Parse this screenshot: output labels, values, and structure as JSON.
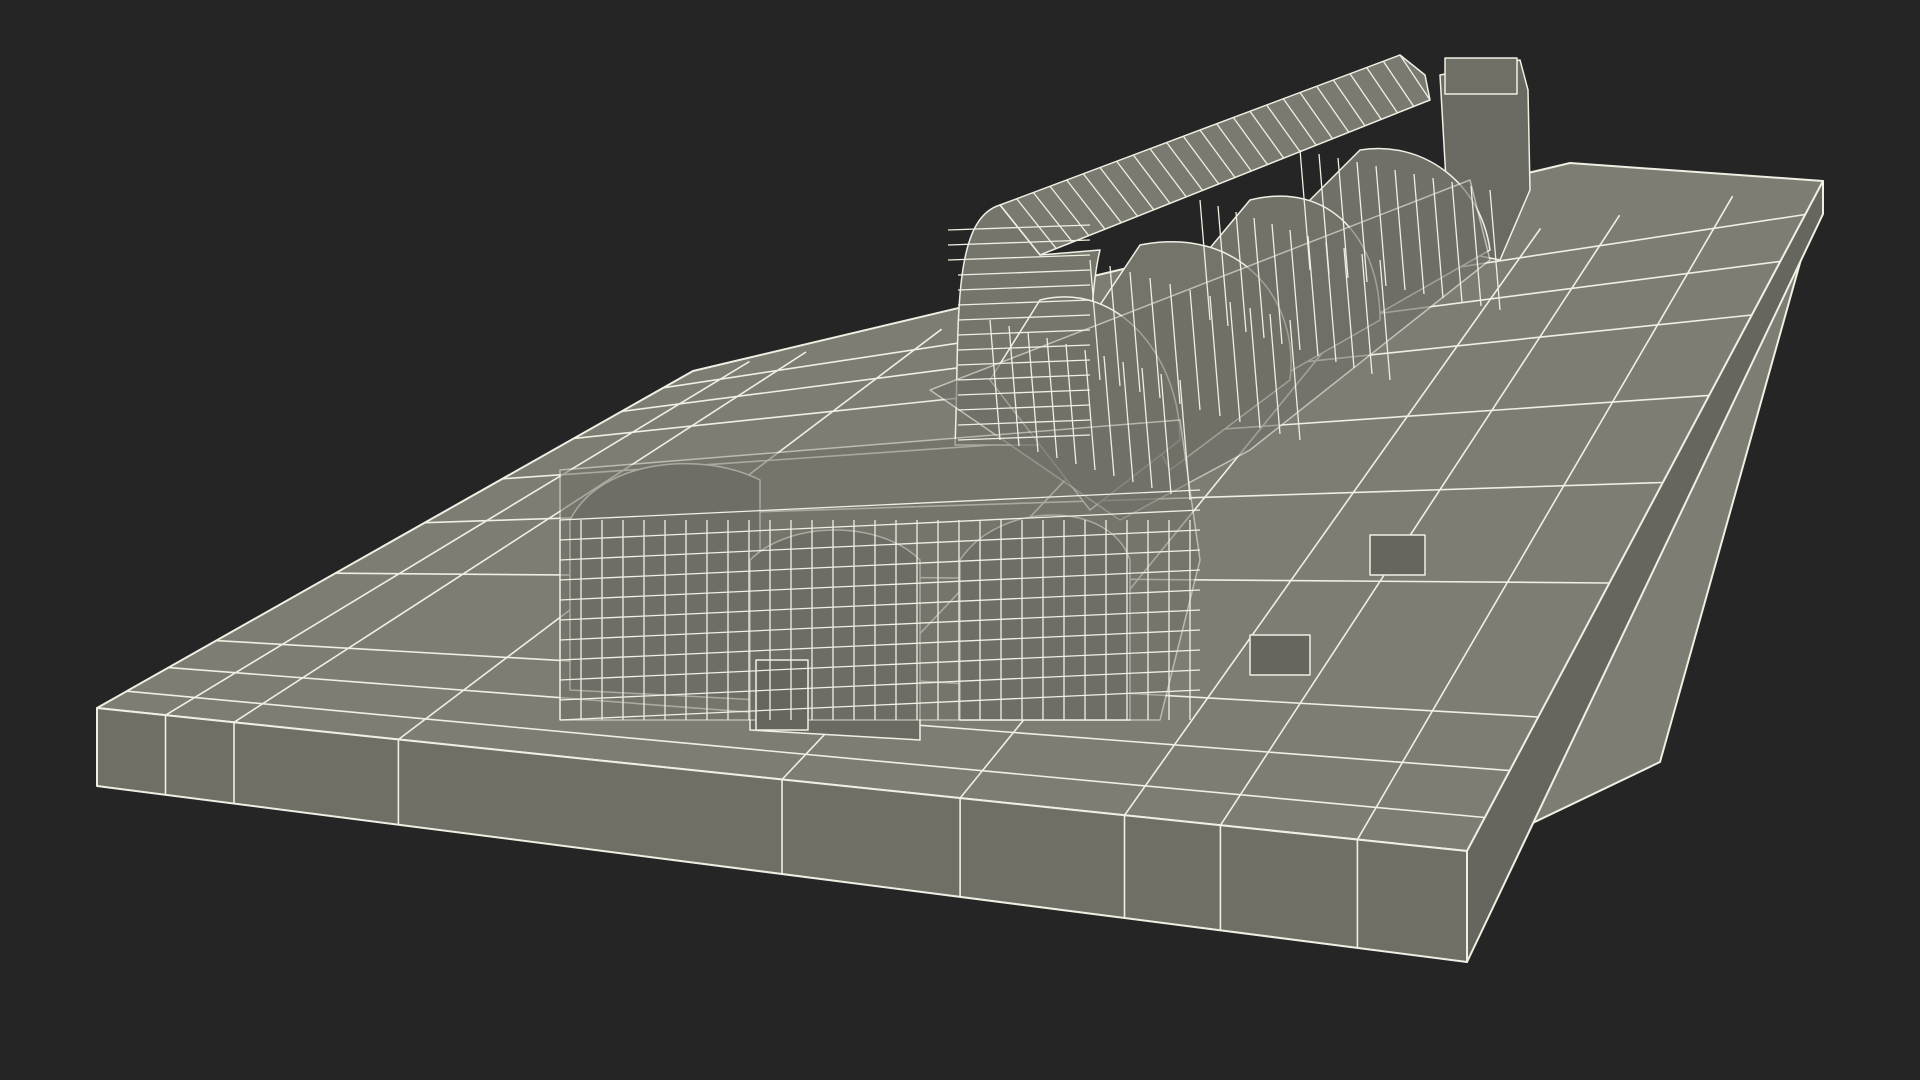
{
  "scene": {
    "subject": "steam-turbine-generator-wireframe",
    "colors": {
      "background": "#252525",
      "slab_top": "#7d7d73",
      "slab_front": "#6f6f66",
      "slab_side": "#66665e",
      "machine": "#75756c",
      "machine_dark": "#5e5e56",
      "wire": "#efefe3"
    }
  }
}
